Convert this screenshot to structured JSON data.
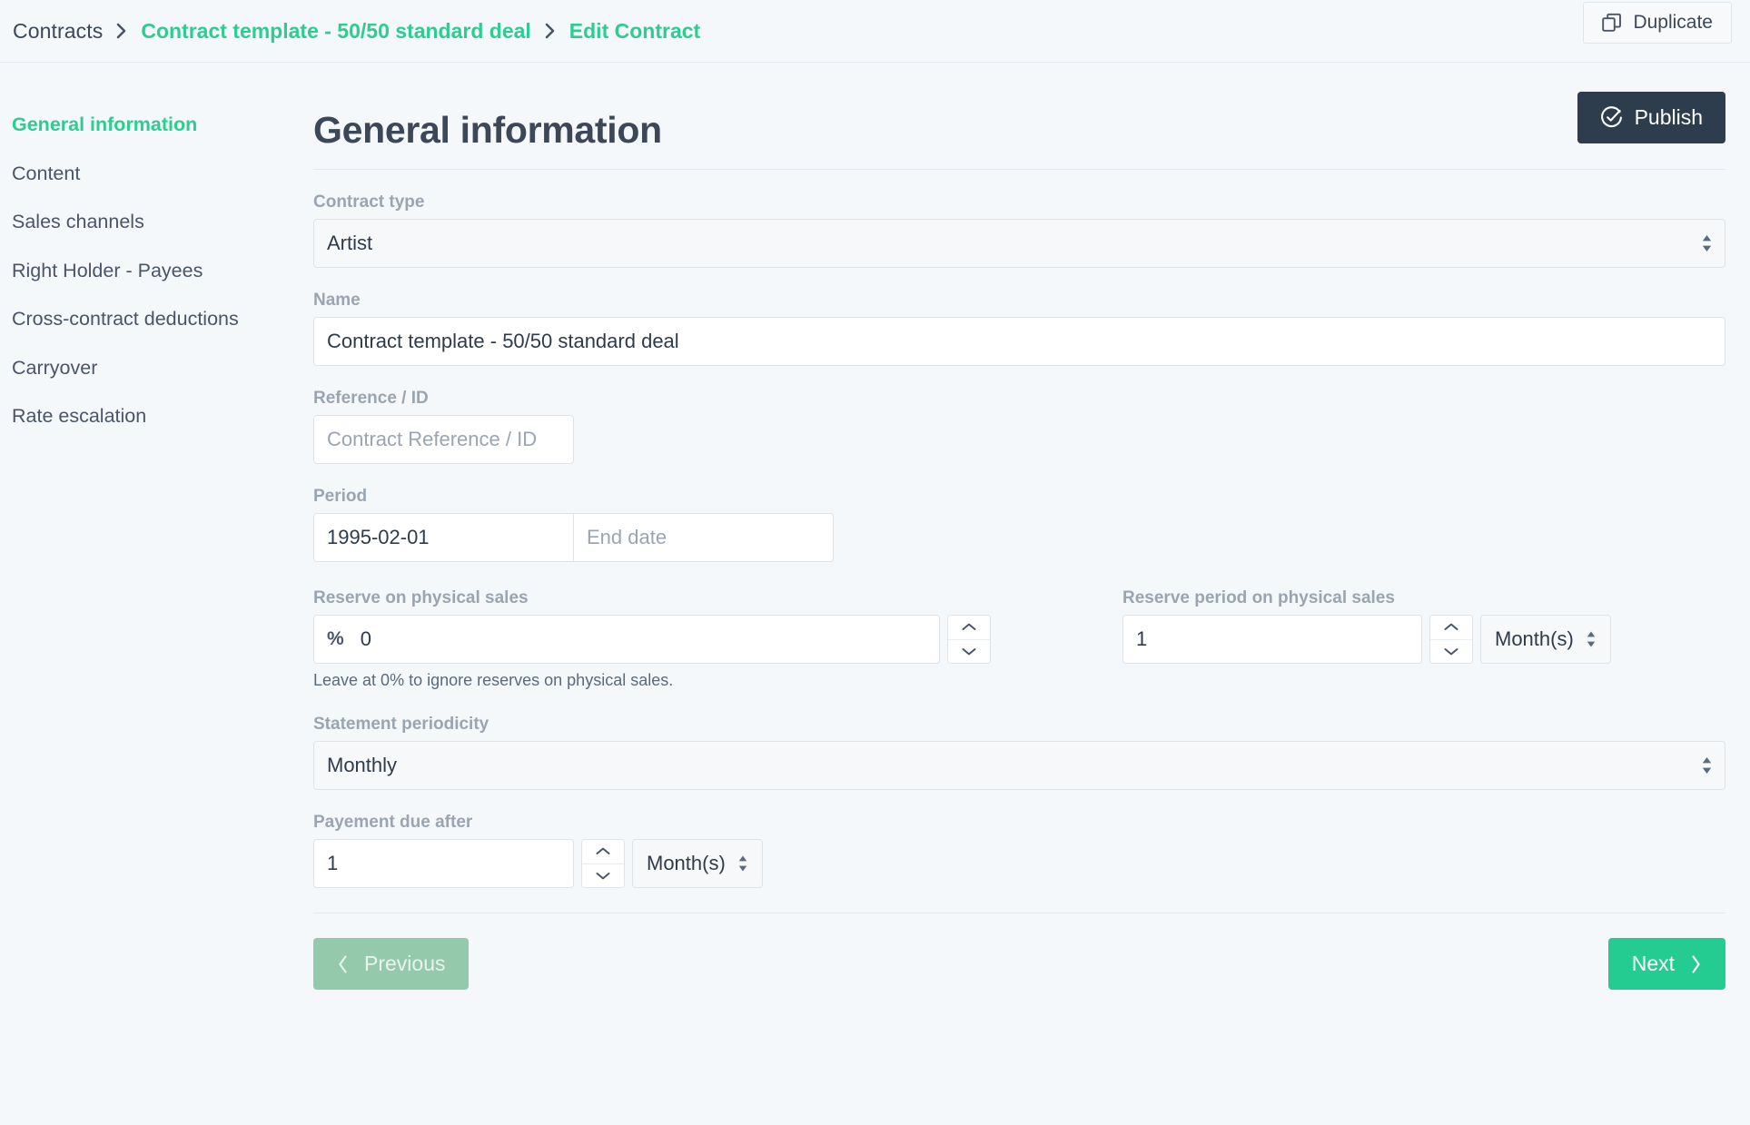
{
  "breadcrumb": {
    "root": "Contracts",
    "middle": "Contract template - 50/50 standard deal",
    "current": "Edit Contract"
  },
  "topbar": {
    "duplicate_label": "Duplicate",
    "duplicate_icon": "copy-icon"
  },
  "sidebar": {
    "items": [
      {
        "label": "General information",
        "active": true
      },
      {
        "label": "Content",
        "active": false
      },
      {
        "label": "Sales channels",
        "active": false
      },
      {
        "label": "Right Holder - Payees",
        "active": false
      },
      {
        "label": "Cross-contract deductions",
        "active": false
      },
      {
        "label": "Carryover",
        "active": false
      },
      {
        "label": "Rate escalation",
        "active": false
      }
    ]
  },
  "main": {
    "title": "General information",
    "publish_label": "Publish",
    "publish_icon": "check-circle-icon"
  },
  "form": {
    "contract_type": {
      "label": "Contract type",
      "value": "Artist"
    },
    "name": {
      "label": "Name",
      "value": "Contract template - 50/50 standard deal"
    },
    "reference": {
      "label": "Reference / ID",
      "value": "",
      "placeholder": "Contract Reference / ID"
    },
    "period": {
      "label": "Period",
      "start_value": "1995-02-01",
      "end_value": "",
      "end_placeholder": "End date"
    },
    "reserve_physical": {
      "label": "Reserve on physical sales",
      "prefix": "%",
      "value": "0",
      "help": "Leave at 0% to ignore reserves on physical sales."
    },
    "reserve_period_physical": {
      "label": "Reserve period on physical sales",
      "value": "1",
      "unit": "Month(s)"
    },
    "statement_periodicity": {
      "label": "Statement periodicity",
      "value": "Monthly"
    },
    "payment_due": {
      "label": "Payement due after",
      "value": "1",
      "unit": "Month(s)"
    }
  },
  "footer": {
    "previous_label": "Previous",
    "next_label": "Next"
  },
  "colors": {
    "accent_green": "#2ecc8f",
    "next_green": "#25cc92",
    "prev_green_disabled": "#94c9ac",
    "publish_dark": "#2e3d4e",
    "page_bg": "#f5f8fa",
    "label_gray": "#9aa5b1",
    "text_dark": "#3c4858"
  }
}
